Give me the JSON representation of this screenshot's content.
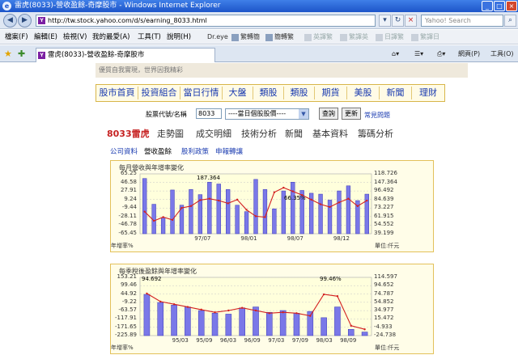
{
  "window": {
    "title": "雷虎(8033)-營收盈餘-奇摩股市 - Windows Internet Explorer",
    "min": "_",
    "max": "□",
    "close": "×"
  },
  "address": {
    "url": "http://tw.stock.yahoo.com/d/s/earning_8033.html",
    "search_placeholder": "Yahoo! Search"
  },
  "menu": {
    "items": [
      "檔案(F)",
      "編輯(E)",
      "檢視(V)",
      "我的最愛(A)",
      "工具(T)",
      "說明(H)"
    ],
    "toolbar": [
      {
        "label": "Dr.eye",
        "dim": false
      },
      {
        "label": "繁轉簡",
        "dim": false
      },
      {
        "label": "簡轉繁",
        "dim": false
      },
      {
        "label": "英譯繁",
        "dim": true
      },
      {
        "label": "繁譯英",
        "dim": true
      },
      {
        "label": "日譯繁",
        "dim": true
      },
      {
        "label": "繁譯日",
        "dim": true
      }
    ]
  },
  "tabs": {
    "active": "雷虎(8033)-營收盈餘-奇摩股市",
    "right_tools": [
      "網頁(P)",
      "工具(O)"
    ]
  },
  "page": {
    "banner": "優質自我實現，世界因我精彩",
    "nav": [
      "股市首頁",
      "投資組合",
      "當日行情",
      "大盤",
      "類股",
      "類股",
      "期貨",
      "美股",
      "新聞",
      "理財"
    ],
    "stock_label": "股票代號/名稱",
    "stock_code": "8033",
    "select_value": "----當日個股股價----",
    "query_btn": "查詢",
    "update_btn": "更新",
    "faq": "常見問題",
    "stock_title": "8033雷虎",
    "subnav": [
      "走勢圖",
      "成交明細",
      "技術分析",
      "新聞",
      "基本資料",
      "籌碼分析"
    ],
    "sublinks": [
      "公司資料",
      "營收盈餘",
      "股利政策",
      "申報轉讓"
    ]
  },
  "chart_data": [
    {
      "type": "bar",
      "title": "每月營收與年增率變化",
      "left_axis_label": "年增率%",
      "right_axis_label": "單位:仟元",
      "y_ticks_left": [
        "65.25",
        "46.58",
        "27.91",
        "9.24",
        "-9.44",
        "-28.11",
        "-46.78",
        "-65.45"
      ],
      "y_ticks_right": [
        "118.726",
        "147.364",
        "96.492",
        "84.639",
        "73.227",
        "61.915",
        "54.552",
        "39.199"
      ],
      "x_ticks": [
        "97/07",
        "98/01",
        "98/07",
        "98/12"
      ],
      "annotations": [
        "187.364",
        "66.35%"
      ],
      "bars": [
        120,
        64,
        35,
        95,
        62,
        96,
        85,
        112,
        108,
        96,
        62,
        48,
        118,
        96,
        54,
        93,
        112,
        94,
        88,
        86,
        73,
        93,
        104,
        72,
        86
      ],
      "line": [
        48,
        28,
        36,
        30,
        56,
        60,
        73,
        76,
        72,
        66,
        74,
        52,
        38,
        36,
        90,
        100,
        92,
        84,
        74,
        64,
        58,
        68,
        76,
        60,
        72
      ]
    },
    {
      "type": "bar",
      "title": "每季稅後盈餘與年增率變化",
      "left_axis_label": "年增率%",
      "right_axis_label": "單位:仟元",
      "y_ticks_left": [
        "153.21",
        "99.46",
        "44.92",
        "-9.22",
        "-63.57",
        "-117.91",
        "-171.65",
        "-225.89"
      ],
      "y_ticks_right": [
        "114.597",
        "94.652",
        "74.787",
        "54.852",
        "34.977",
        "15.472",
        "-4.933",
        "-24.738"
      ],
      "x_ticks": [
        "95/03",
        "95/09",
        "96/03",
        "96/09",
        "97/03",
        "97/09",
        "98/03",
        "98/09"
      ],
      "annotations": [
        "94.692",
        "99.46%"
      ],
      "bars": [
        92,
        74,
        68,
        64,
        56,
        50,
        48,
        62,
        64,
        52,
        56,
        50,
        54,
        40,
        64,
        14,
        8
      ],
      "line": [
        94,
        76,
        70,
        64,
        58,
        52,
        56,
        62,
        56,
        50,
        52,
        50,
        44,
        92,
        88,
        22,
        14
      ]
    }
  ]
}
